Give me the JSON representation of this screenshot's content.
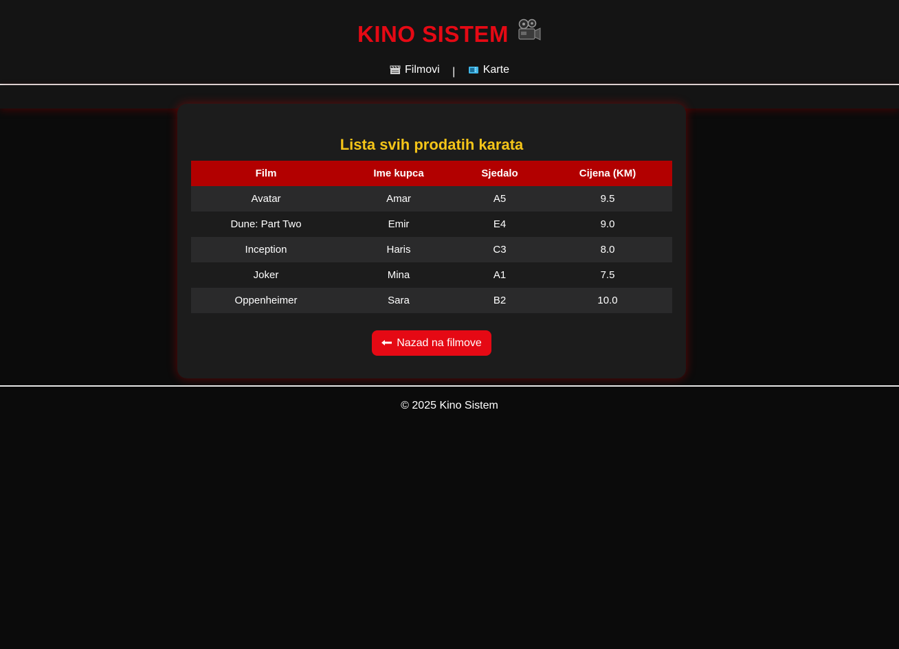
{
  "site": {
    "title": "KINO SISTEM",
    "title_icon": "movie-camera-icon",
    "accent_color": "#e50914",
    "heading_color": "#f5c518"
  },
  "nav": {
    "items": [
      {
        "label": "Filmovi",
        "icon": "clapperboard-icon"
      },
      {
        "label": "Karte",
        "icon": "ticket-icon"
      }
    ],
    "separator": "|"
  },
  "card": {
    "title": "Lista svih prodatih karata",
    "table": {
      "headers": [
        "Film",
        "Ime kupca",
        "Sjedalo",
        "Cijena (KM)"
      ],
      "header_color": "#b20000",
      "rows": [
        [
          "Avatar",
          "Amar",
          "A5",
          "9.5"
        ],
        [
          "Dune: Part Two",
          "Emir",
          "E4",
          "9.0"
        ],
        [
          "Inception",
          "Haris",
          "C3",
          "8.0"
        ],
        [
          "Joker",
          "Mina",
          "A1",
          "7.5"
        ],
        [
          "Oppenheimer",
          "Sara",
          "B2",
          "10.0"
        ]
      ]
    },
    "back_button": {
      "label": "Nazad na filmove",
      "icon": "arrow-left-icon"
    }
  },
  "footer": {
    "text": "© 2025 Kino Sistem"
  }
}
